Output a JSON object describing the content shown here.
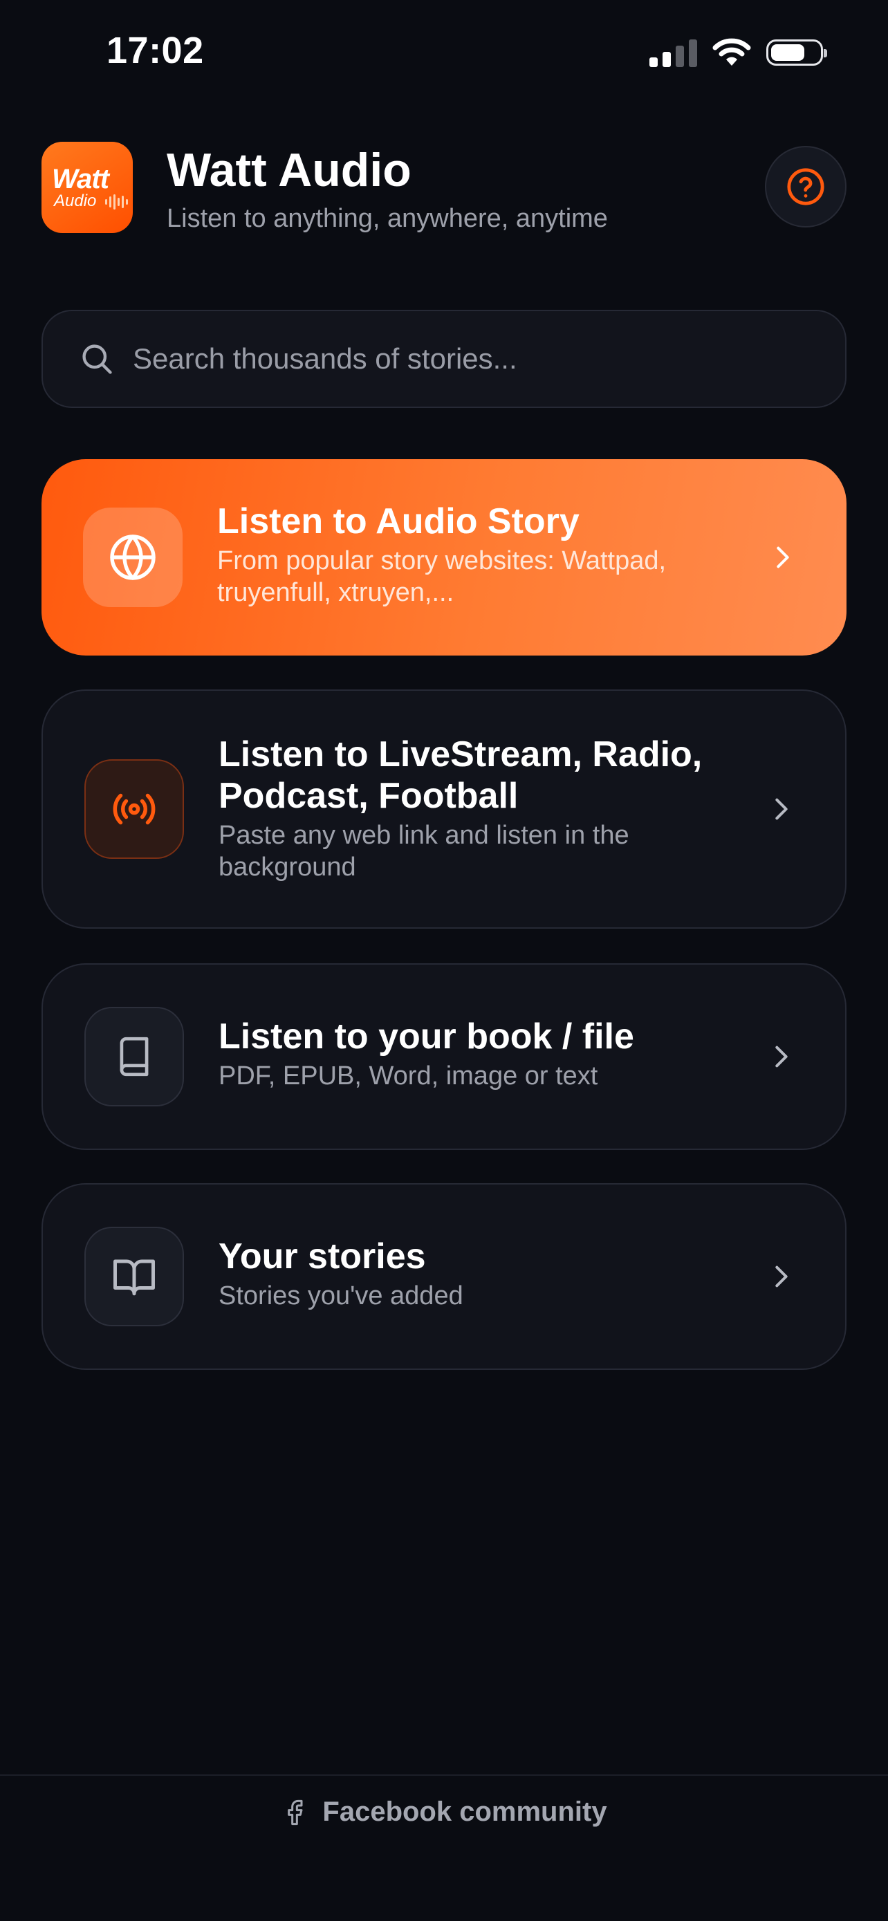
{
  "status_bar": {
    "time": "17:02"
  },
  "header": {
    "logo_text_top": "Watt",
    "logo_text_bottom": "Audio",
    "title": "Watt Audio",
    "subtitle": "Listen to anything, anywhere, anytime",
    "help_icon": "question-circle-icon"
  },
  "search": {
    "placeholder": "Search thousands of stories...",
    "value": ""
  },
  "cards": [
    {
      "icon": "globe-icon",
      "title": "Listen to Audio Story",
      "description": "From popular story websites: Wattpad, truyenfull, xtruyen,..."
    },
    {
      "icon": "broadcast-icon",
      "title": "Listen to LiveStream, Radio, Podcast, Football",
      "description": "Paste any web link and listen in the background"
    },
    {
      "icon": "book-icon",
      "title": "Listen to your book / file",
      "description": "PDF, EPUB, Word, image or text"
    },
    {
      "icon": "open-book-icon",
      "title": "Your stories",
      "description": "Stories you've added"
    }
  ],
  "footer": {
    "icon": "facebook-icon",
    "label": "Facebook community"
  },
  "colors": {
    "accent": "#ff5a0e",
    "background": "#0a0c12",
    "card": "#11131b"
  }
}
